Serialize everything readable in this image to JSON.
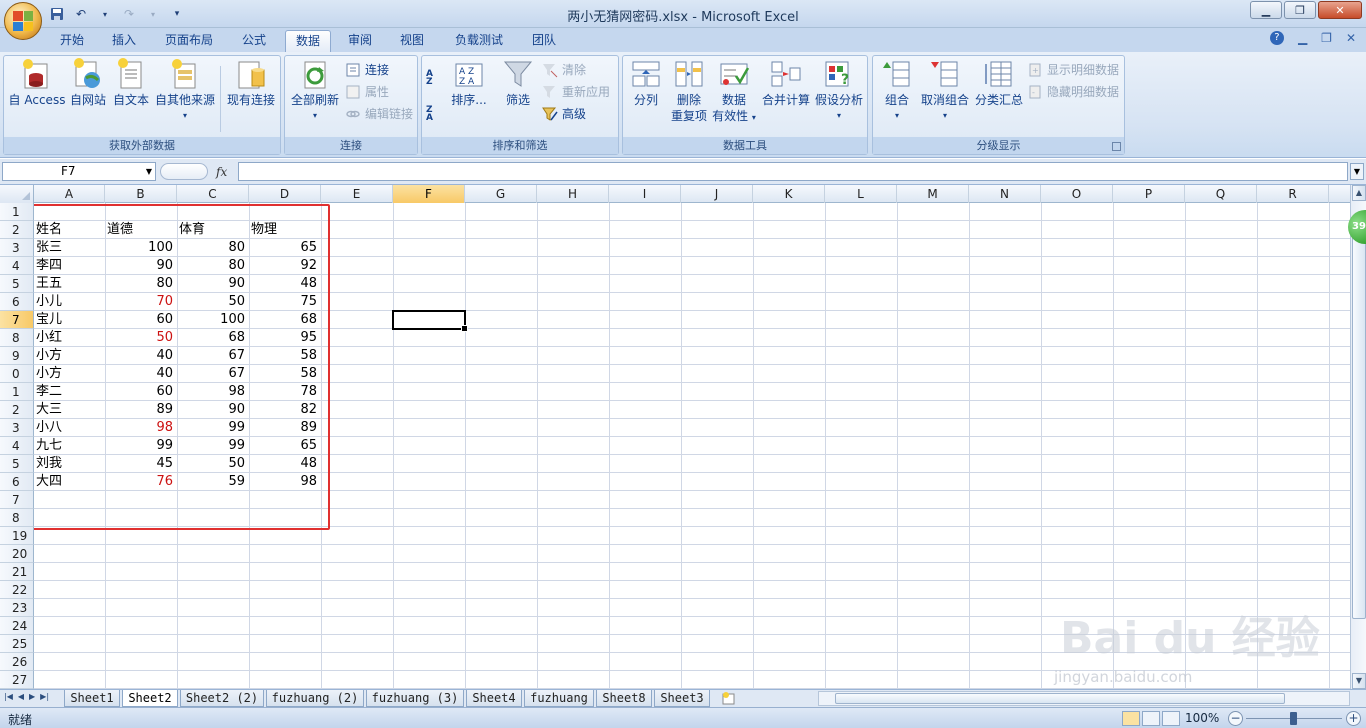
{
  "window": {
    "title": "两小无猜网密码.xlsx - Microsoft Excel"
  },
  "tabs": [
    "开始",
    "插入",
    "页面布局",
    "公式",
    "数据",
    "审阅",
    "视图",
    "负载测试",
    "团队"
  ],
  "active_tab": "数据",
  "ribbon": {
    "external": {
      "label": "获取外部数据",
      "access": "自 Access",
      "web": "自网站",
      "text": "自文本",
      "other": "自其他来源",
      "existing": "现有连接"
    },
    "connections": {
      "label": "连接",
      "refresh_all": "全部刷新",
      "connections": "连接",
      "properties": "属性",
      "edit_links": "编辑链接"
    },
    "sort_filter": {
      "label": "排序和筛选",
      "sort": "排序...",
      "filter": "筛选",
      "clear": "清除",
      "reapply": "重新应用",
      "advanced": "高级"
    },
    "data_tools": {
      "label": "数据工具",
      "text_to_columns": "分列",
      "remove_dup_1": "删除",
      "remove_dup_2": "重复项",
      "validation_1": "数据",
      "validation_2": "有效性",
      "consolidate": "合并计算",
      "what_if": "假设分析"
    },
    "outline": {
      "label": "分级显示",
      "group": "组合",
      "ungroup": "取消组合",
      "subtotal": "分类汇总",
      "show_detail": "显示明细数据",
      "hide_detail": "隐藏明细数据"
    }
  },
  "formula_bar": {
    "name_box": "F7",
    "fx": "fx",
    "formula": ""
  },
  "columns": [
    "A",
    "B",
    "C",
    "D",
    "E",
    "F",
    "G",
    "H",
    "I",
    "J",
    "K",
    "L",
    "M",
    "N",
    "O",
    "P",
    "Q",
    "R"
  ],
  "selected_column": "F",
  "row_numbers": [
    "1",
    "2",
    "3",
    "4",
    "5",
    "6",
    "7",
    "8",
    "9",
    "0",
    "1",
    "2",
    "3",
    "4",
    "5",
    "6",
    "7",
    "8",
    "19",
    "20",
    "21",
    "22",
    "23",
    "24",
    "25",
    "26",
    "27"
  ],
  "selected_row": "7",
  "table": {
    "headers": [
      "姓名",
      "道德",
      "体育",
      "物理"
    ],
    "rows": [
      [
        "张三",
        "100",
        "80",
        "65"
      ],
      [
        "李四",
        "90",
        "80",
        "92"
      ],
      [
        "王五",
        "80",
        "90",
        "48"
      ],
      [
        "小儿",
        "70",
        "50",
        "75"
      ],
      [
        "宝儿",
        "60",
        "100",
        "68"
      ],
      [
        "小红",
        "50",
        "68",
        "95"
      ],
      [
        "小方",
        "40",
        "67",
        "58"
      ],
      [
        "小方",
        "40",
        "67",
        "58"
      ],
      [
        "李二",
        "60",
        "98",
        "78"
      ],
      [
        "大三",
        "89",
        "90",
        "82"
      ],
      [
        "小八",
        "98",
        "99",
        "89"
      ],
      [
        "九七",
        "99",
        "99",
        "65"
      ],
      [
        "刘我",
        "45",
        "50",
        "48"
      ],
      [
        "大四",
        "76",
        "59",
        "98"
      ]
    ],
    "red_value_rows": [
      3,
      5,
      10,
      13
    ],
    "red_color": "#cc1111"
  },
  "sheet_tabs": [
    "Sheet1",
    "Sheet2",
    "Sheet2 (2)",
    "fuzhuang (2)",
    "fuzhuang (3)",
    "Sheet4",
    "fuzhuang",
    "Sheet8",
    "Sheet3"
  ],
  "active_sheet": "Sheet2",
  "status": {
    "text": "就绪",
    "zoom": "100%"
  },
  "side_badge": "39",
  "watermark": {
    "main": "Bai du 经验",
    "sub": "jingyan.baidu.com"
  }
}
